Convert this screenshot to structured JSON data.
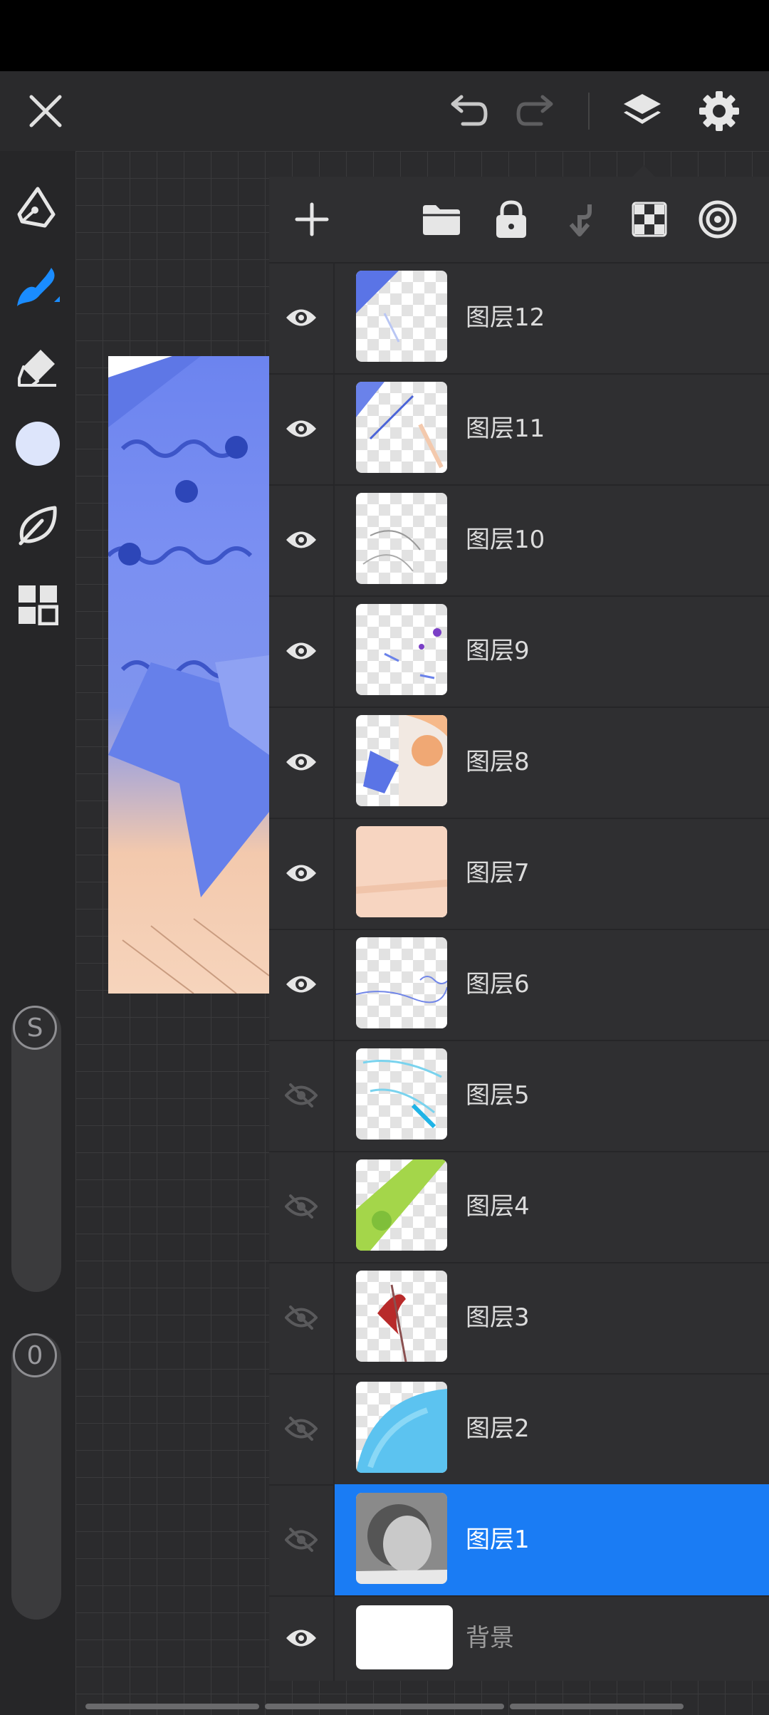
{
  "top_toolbar": {
    "close": "close-icon",
    "undo": "undo-icon",
    "redo": "redo-icon",
    "layers": "layers-icon",
    "settings": "gear-icon"
  },
  "left_tools": [
    {
      "name": "pen-tool",
      "icon": "pen-icon"
    },
    {
      "name": "brush-tool",
      "icon": "brush-icon",
      "accent": "#1a8cff"
    },
    {
      "name": "eraser-tool",
      "icon": "eraser-icon"
    },
    {
      "name": "color-swatch",
      "icon": "color-circle",
      "color": "#dde5fb"
    },
    {
      "name": "smudge-tool",
      "icon": "leaf-icon"
    },
    {
      "name": "gallery-tool",
      "icon": "grid-icon"
    }
  ],
  "sliders": {
    "size_label": "S",
    "opacity_label": "0"
  },
  "layer_panel": {
    "toolbar_icons": [
      "add-icon",
      "folder-icon",
      "lock-icon",
      "merge-down-icon",
      "transparency-icon",
      "target-icon"
    ],
    "layers": [
      {
        "name": "图层12",
        "visible": true,
        "selected": false
      },
      {
        "name": "图层11",
        "visible": true,
        "selected": false
      },
      {
        "name": "图层10",
        "visible": true,
        "selected": false
      },
      {
        "name": "图层9",
        "visible": true,
        "selected": false
      },
      {
        "name": "图层8",
        "visible": true,
        "selected": false
      },
      {
        "name": "图层7",
        "visible": true,
        "selected": false
      },
      {
        "name": "图层6",
        "visible": true,
        "selected": false
      },
      {
        "name": "图层5",
        "visible": false,
        "selected": false
      },
      {
        "name": "图层4",
        "visible": false,
        "selected": false
      },
      {
        "name": "图层3",
        "visible": false,
        "selected": false
      },
      {
        "name": "图层2",
        "visible": false,
        "selected": false
      },
      {
        "name": "图层1",
        "visible": false,
        "selected": true
      }
    ],
    "background": {
      "name": "背景",
      "visible": true
    }
  },
  "colors": {
    "selected_layer": "#1a7cf4",
    "brush_accent": "#1a8cff",
    "panel_bg": "#2f2f31"
  }
}
